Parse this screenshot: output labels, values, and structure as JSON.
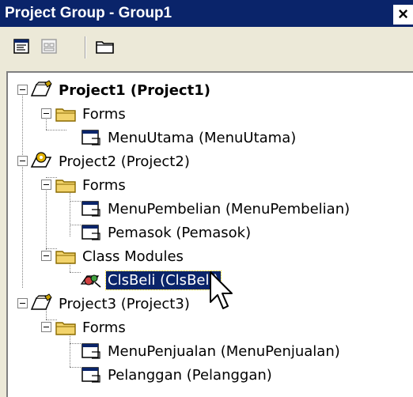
{
  "window": {
    "title": "Project Group - Group1",
    "close_glyph": "×"
  },
  "toolbar": {
    "buttons": [
      {
        "name": "view-code-button",
        "icon": "view-code-icon"
      },
      {
        "name": "view-object-button",
        "icon": "view-object-icon"
      },
      {
        "name": "toggle-folders-button",
        "icon": "folder-icon"
      }
    ]
  },
  "tree": {
    "nodes": [
      {
        "id": "p1",
        "label": "Project1 (Project1)",
        "type": "project",
        "bold": true,
        "expanded": true
      },
      {
        "id": "p1f",
        "label": "Forms",
        "type": "folder",
        "expanded": true
      },
      {
        "id": "p1f1",
        "label": "MenuUtama (MenuUtama)",
        "type": "form"
      },
      {
        "id": "p2",
        "label": "Project2 (Project2)",
        "type": "project-activex",
        "expanded": true
      },
      {
        "id": "p2f",
        "label": "Forms",
        "type": "folder",
        "expanded": true
      },
      {
        "id": "p2f1",
        "label": "MenuPembelian (MenuPembelian)",
        "type": "form"
      },
      {
        "id": "p2f2",
        "label": "Pemasok (Pemasok)",
        "type": "form"
      },
      {
        "id": "p2c",
        "label": "Class Modules",
        "type": "folder",
        "expanded": true
      },
      {
        "id": "p2c1",
        "label": "ClsBeli (ClsBeli)",
        "type": "class-module",
        "selected": true
      },
      {
        "id": "p3",
        "label": "Project3 (Project3)",
        "type": "project",
        "expanded": true
      },
      {
        "id": "p3f",
        "label": "Forms",
        "type": "folder",
        "expanded": true
      },
      {
        "id": "p3f1",
        "label": "MenuPenjualan (MenuPenjualan)",
        "type": "form"
      },
      {
        "id": "p3f2",
        "label": "Pelanggan (Pelanggan)",
        "type": "form"
      }
    ]
  },
  "colors": {
    "titlebar": "#0a246a",
    "selection": "#0a246a",
    "folder": "#f2d36b",
    "window_bg": "#ece9d8"
  }
}
